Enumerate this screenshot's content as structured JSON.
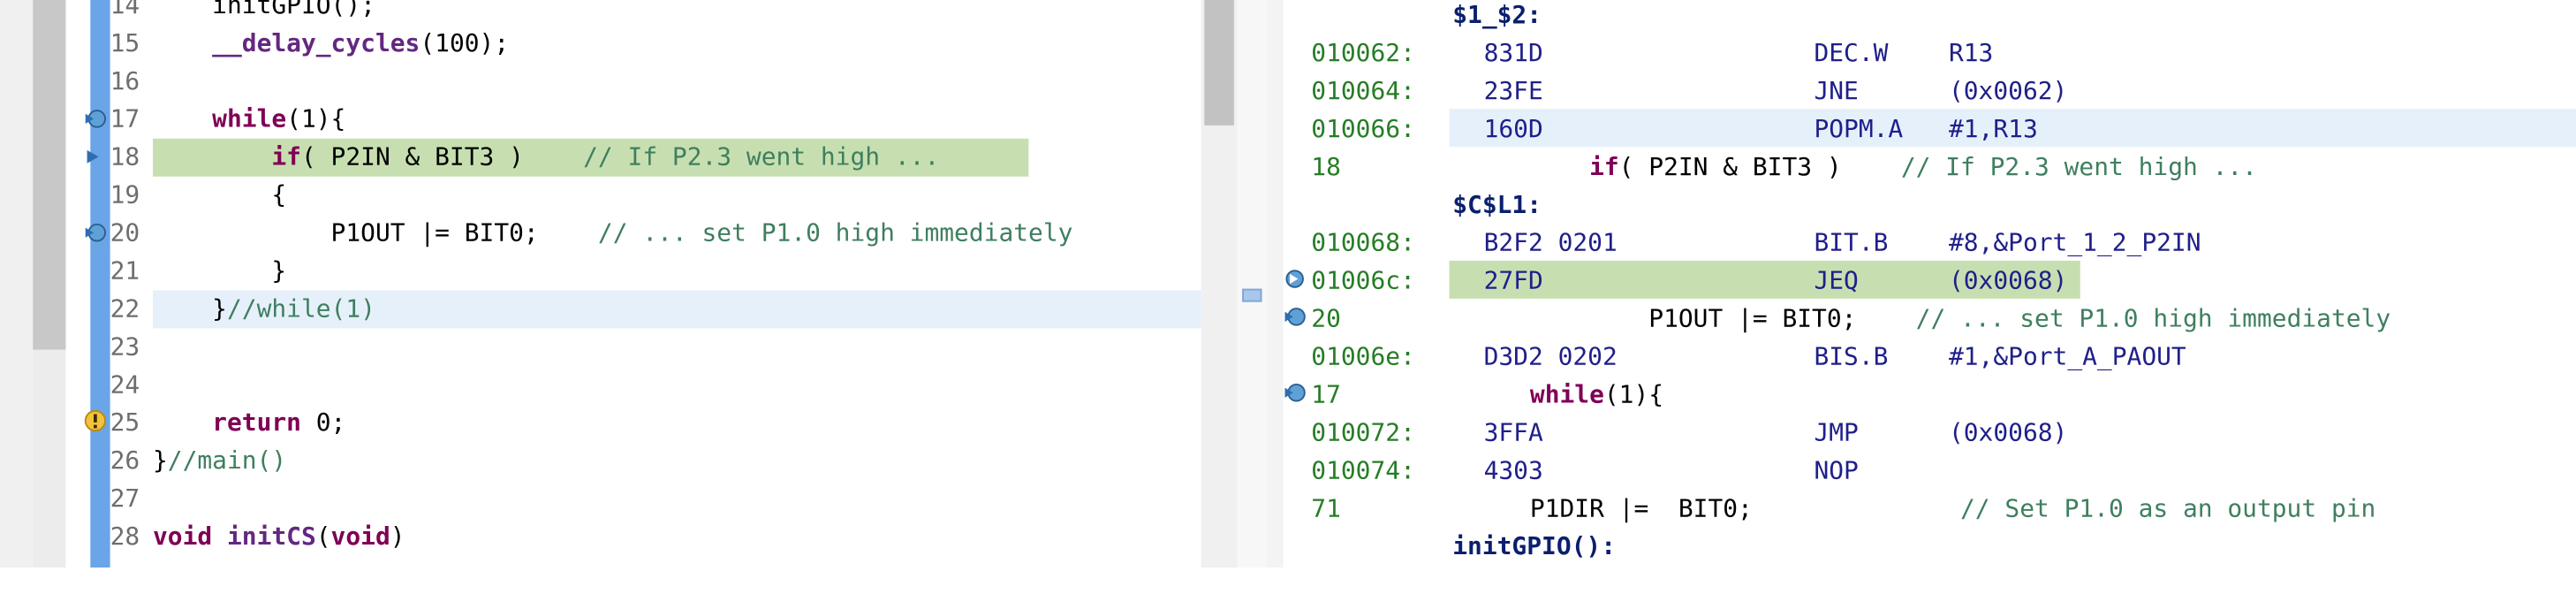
{
  "colors": {
    "current_line": "#c7dfb0",
    "highlight_line": "#e6f0fb",
    "keyword": "#7f0055",
    "comment": "#3f7f5f",
    "address": "#267d26",
    "label": "#0b1f6e"
  },
  "editor": {
    "lines": [
      {
        "n": "14",
        "text": "    initGPIO();"
      },
      {
        "n": "15",
        "text": "    __delay_cycles(100);"
      },
      {
        "n": "16",
        "text": ""
      },
      {
        "n": "17",
        "text": "    while(1){"
      },
      {
        "n": "18",
        "text": "        if( P2IN & BIT3 )    // If P2.3 went high ..."
      },
      {
        "n": "19",
        "text": "        {"
      },
      {
        "n": "20",
        "text": "            P1OUT |= BIT0;    // ... set P1.0 high immediately"
      },
      {
        "n": "21",
        "text": "        }"
      },
      {
        "n": "22",
        "text": "    }//while(1)"
      },
      {
        "n": "23",
        "text": ""
      },
      {
        "n": "24",
        "text": ""
      },
      {
        "n": "25",
        "text": "    return 0;"
      },
      {
        "n": "26",
        "text": "}//main()"
      },
      {
        "n": "27",
        "text": ""
      },
      {
        "n": "28",
        "text": "void initCS(void)"
      }
    ]
  },
  "disassembly": {
    "rows": [
      {
        "type": "label",
        "text": "$1_$2:"
      },
      {
        "type": "ins",
        "addr": "010062:",
        "op": "831D",
        "mn": "DEC.W",
        "args": "R13"
      },
      {
        "type": "ins",
        "addr": "010064:",
        "op": "23FE",
        "mn": "JNE",
        "args": "(0x0062)"
      },
      {
        "type": "ins",
        "addr": "010066:",
        "op": "160D",
        "mn": "POPM.A",
        "args": "#1,R13"
      },
      {
        "type": "src",
        "addr": "18",
        "text": "        if( P2IN & BIT3 )    // If P2.3 went high ..."
      },
      {
        "type": "label",
        "text": "$C$L1:"
      },
      {
        "type": "ins",
        "addr": "010068:",
        "op": "B2F2 0201",
        "mn": "BIT.B",
        "args": "#8,&Port_1_2_P2IN"
      },
      {
        "type": "ins",
        "addr": "01006c:",
        "op": "27FD",
        "mn": "JEQ",
        "args": "(0x0068)"
      },
      {
        "type": "src",
        "addr": "20",
        "text": "            P1OUT |= BIT0;    // ... set P1.0 high immediately"
      },
      {
        "type": "ins",
        "addr": "01006e:",
        "op": "D3D2 0202",
        "mn": "BIS.B",
        "args": "#1,&Port_A_PAOUT"
      },
      {
        "type": "src",
        "addr": "17",
        "text": "    while(1){"
      },
      {
        "type": "ins",
        "addr": "010072:",
        "op": "3FFA",
        "mn": "JMP",
        "args": "(0x0068)"
      },
      {
        "type": "ins",
        "addr": "010074:",
        "op": "4303",
        "mn": "NOP",
        "args": ""
      },
      {
        "type": "src",
        "addr": "71",
        "text": "    P1DIR |=  BIT0;              // Set P1.0 as an output pin"
      },
      {
        "type": "label",
        "text": "initGPIO():"
      }
    ]
  }
}
